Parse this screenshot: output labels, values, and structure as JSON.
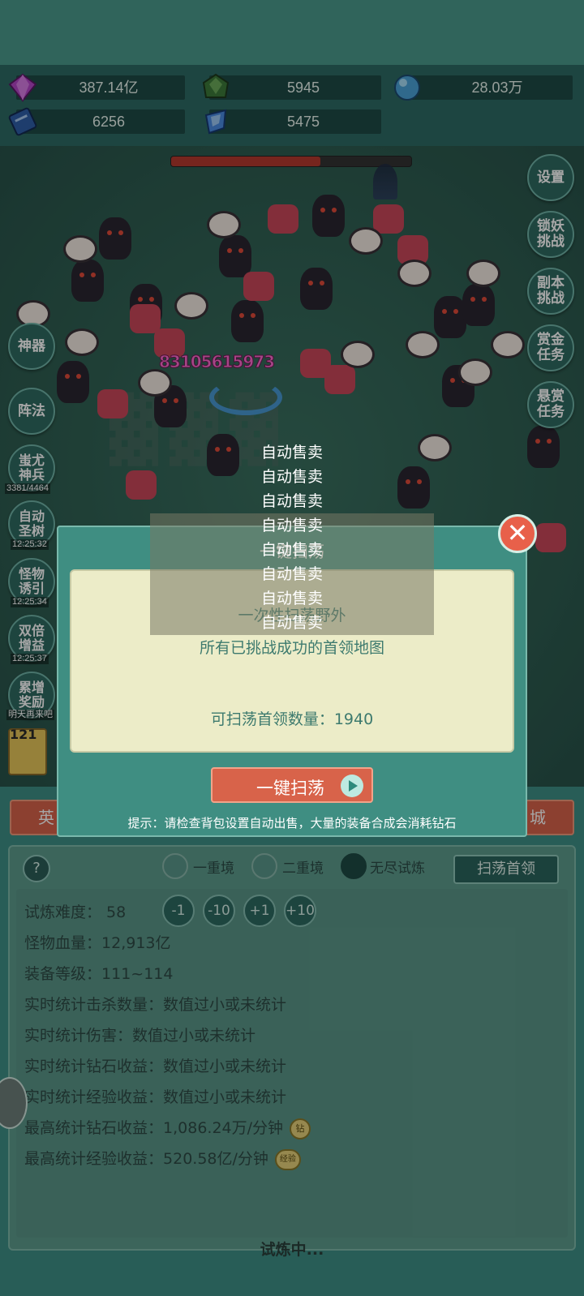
{
  "resources": [
    {
      "icon": "purple-diamond-icon",
      "value": "387.14亿"
    },
    {
      "icon": "green-gem-icon",
      "value": "5945"
    },
    {
      "icon": "blue-orb-icon",
      "value": "28.03万"
    },
    {
      "icon": "blue-book-icon",
      "value": "6256"
    },
    {
      "icon": "blue-crystal-icon",
      "value": "5475"
    }
  ],
  "battle": {
    "boss_hp_fraction": 0.62,
    "damage_number": "83105615973",
    "left_buttons": [
      {
        "name": "artifact",
        "label": "神器",
        "sub": ""
      },
      {
        "name": "formation",
        "label": "阵法",
        "sub": ""
      },
      {
        "name": "chiyou-soldiers",
        "label": "蚩尤\n神兵",
        "sub": "3381/4464"
      },
      {
        "name": "auto-sacred-tree",
        "label": "自动\n圣树",
        "sub": "12:25:32"
      },
      {
        "name": "monster-lure",
        "label": "怪物\n诱引",
        "sub": "12:25:34"
      },
      {
        "name": "double-gain",
        "label": "双倍\n增益",
        "sub": "12:25:37"
      },
      {
        "name": "cumulative-reward",
        "label": "累增\n奖励",
        "sub": "明天再来吧"
      }
    ],
    "right_buttons": [
      {
        "name": "settings",
        "label": "设置"
      },
      {
        "name": "lock-demon-challenge",
        "label": "锁妖\n挑战"
      },
      {
        "name": "dungeon-challenge",
        "label": "副本\n挑战"
      },
      {
        "name": "bounty-mission",
        "label": "赏金\n任务"
      },
      {
        "name": "reward-mission",
        "label": "悬赏\n任务"
      }
    ],
    "sell_log": [
      "自动售卖",
      "自动售卖",
      "自动售卖",
      "自动售卖",
      "自动售卖",
      "自动售卖",
      "自动售卖",
      "自动售卖"
    ],
    "weapon_level": "121"
  },
  "dialog": {
    "title": "一键扫荡",
    "line1": "一次性扫荡野外",
    "line2": "所有已挑战成功的首领地图",
    "count_label": "可扫荡首领数量：1940",
    "button_label": "一键扫荡",
    "hint": "提示：请检查背包设置自动出售，大量的装备合成会消耗钻石",
    "close": "✕"
  },
  "tabs": {
    "left": "英",
    "right": "城"
  },
  "trial": {
    "help": "?",
    "radios": [
      {
        "label": "一重境",
        "selected": false
      },
      {
        "label": "二重境",
        "selected": false
      },
      {
        "label": "无尽试炼",
        "selected": true
      }
    ],
    "sweep_boss_button": "扫荡首领",
    "difficulty_label": "试炼难度：",
    "difficulty_value": "58",
    "diff_buttons": [
      "-1",
      "-10",
      "+1",
      "+10"
    ],
    "rows": [
      {
        "label": "怪物血量：",
        "value": "12,913亿"
      },
      {
        "label": "装备等级：",
        "value": "111~114"
      },
      {
        "label": "实时统计击杀数量：",
        "value": "数值过小或未统计"
      },
      {
        "label": "实时统计伤害：",
        "value": "数值过小或未统计"
      },
      {
        "label": "实时统计钻石收益：",
        "value": "数值过小或未统计"
      },
      {
        "label": "实时统计经验收益：",
        "value": "数值过小或未统计"
      },
      {
        "label": "最高统计钻石收益：",
        "value": "1,086.24万/分钟",
        "badge": "钻"
      },
      {
        "label": "最高统计经验收益：",
        "value": "520.58亿/分钟",
        "badge": "经验"
      }
    ],
    "status": "试炼中..."
  }
}
